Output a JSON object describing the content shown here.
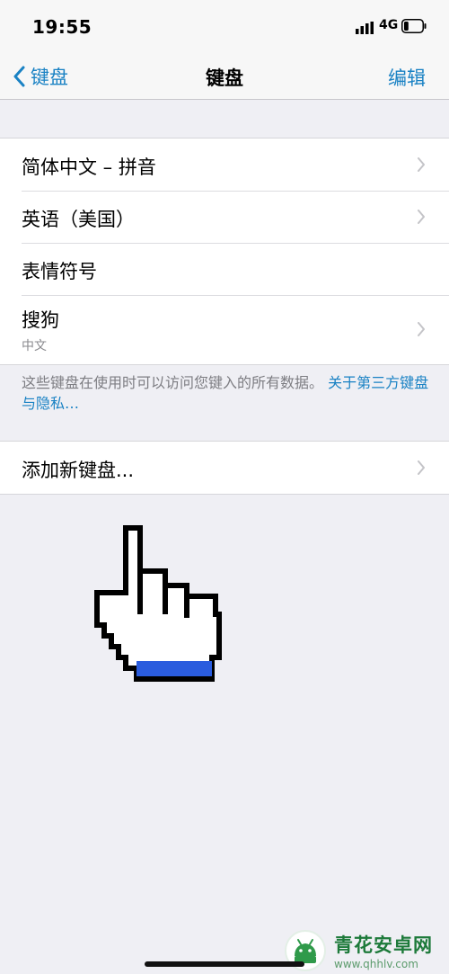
{
  "status_bar": {
    "time": "19:55",
    "network": "4G",
    "battery_level": 0.25
  },
  "nav": {
    "back_label": "键盘",
    "title": "键盘",
    "edit_label": "编辑"
  },
  "keyboards": [
    {
      "label": "简体中文 – 拼音",
      "subtitle": "",
      "has_chevron": true
    },
    {
      "label": "英语（美国）",
      "subtitle": "",
      "has_chevron": true
    },
    {
      "label": "表情符号",
      "subtitle": "",
      "has_chevron": false
    },
    {
      "label": "搜狗",
      "subtitle": "中文",
      "has_chevron": true
    }
  ],
  "footnote": {
    "text": "这些键盘在使用时可以访问您键入的所有数据。",
    "link": "关于第三方键盘与隐私…"
  },
  "add_keyboard": {
    "label": "添加新键盘..."
  },
  "watermark": {
    "title": "青花安卓网",
    "url": "www.qhhlv.com"
  },
  "colors": {
    "accent": "#1a82c4",
    "background": "#efeff4",
    "pointer_blue": "#2a5cde"
  }
}
